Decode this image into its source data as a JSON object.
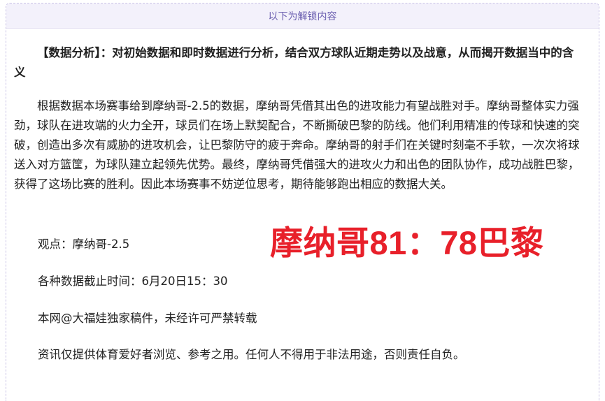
{
  "unlock_bar": {
    "label": "以下为解锁内容"
  },
  "article": {
    "heading": "【数据分析】：对初始数据和即时数据进行分析，结合双方球队近期走势以及战意，从而揭开数据当中的含义",
    "body": "根据数据本场赛事给到摩纳哥-2.5的数据，摩纳哥凭借其出色的进攻能力有望战胜对手。摩纳哥整体实力强劲，球队在进攻端的火力全开，球员们在场上默契配合，不断撕破巴黎的防线。他们利用精准的传球和快速的突破，创造出多次有威胁的进攻机会，让巴黎防守的疲于奔命。摩纳哥的射手们在关键时刻毫不手软，一次次将球送入对方篮筐，为球队建立起领先优势。最终，摩纳哥凭借强大的进攻火力和出色的团队协作，成功战胜巴黎，获得了这场比赛的胜利。因此本场赛事不妨逆位思考，期待能够跑出相应的数据大关。",
    "viewpoint": "观点：摩纳哥-2.5",
    "cutoff": "各种数据截止时间：6月20日15：30",
    "copyright": "本网@大福娃独家稿件，未经许可严禁转载",
    "disclaimer": "资讯仅提供体育爱好者浏览、参考之用。任何人不得用于非法用途，否则责任自负。"
  },
  "score_overlay": {
    "text": "摩纳哥81：78巴黎",
    "color": "#e8202a"
  }
}
